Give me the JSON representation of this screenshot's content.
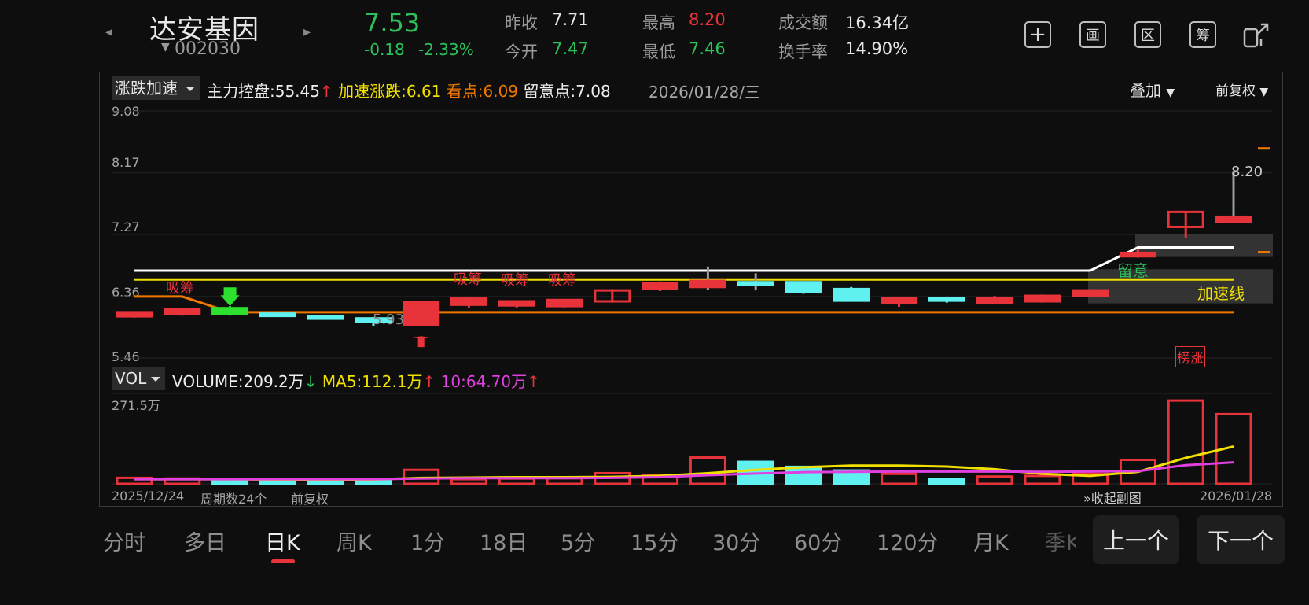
{
  "header": {
    "name": "达安基因",
    "code": "002030",
    "price": "7.53",
    "change": "-0.18",
    "change_pct": "-2.33%",
    "stats": [
      {
        "label": "昨收",
        "value": "7.71"
      },
      {
        "label": "今开",
        "value": "7.47"
      },
      {
        "label": "最高",
        "value": "8.20"
      },
      {
        "label": "最低",
        "value": "7.46"
      },
      {
        "label": "成交额",
        "value": "16.34亿"
      },
      {
        "label": "换手率",
        "value": "14.90%"
      }
    ],
    "tools": [
      "+",
      "画",
      "区",
      "筹",
      "分享"
    ]
  },
  "chart_header": {
    "indicator": "涨跌加速",
    "main_ctrl": "主力控盘:55.45",
    "accel": "加速涨跌:6.61",
    "watch": "看点:6.09",
    "attention": "留意点:7.08",
    "date": "2026/01/28/三",
    "overlay": "叠加",
    "adjust": "前复权"
  },
  "price_axis": [
    "9.08",
    "8.17",
    "7.27",
    "6.36",
    "5.46"
  ],
  "annotations": {
    "xichou": "吸筹",
    "liuyi": "留意",
    "accel_line": "加速线",
    "bangzhang": "榜涨",
    "high": "8.20",
    "low": "5.93"
  },
  "volume_header": {
    "indicator": "VOL",
    "volume": "VOLUME:209.2万",
    "ma5": "MA5:112.1万",
    "ma10": "10:64.70万",
    "axis_max": "271.5万"
  },
  "footer": {
    "start": "2025/12/24",
    "period": "周期数24个",
    "adjust": "前复权",
    "collapse": "收起副图",
    "end": "2026/01/28"
  },
  "tabs": [
    "分时",
    "多日",
    "日K",
    "周K",
    "1分",
    "18日",
    "5分",
    "15分",
    "30分",
    "60分",
    "120分",
    "月K",
    "季K"
  ],
  "nav": {
    "prev": "上一个",
    "next": "下一个"
  },
  "colors": {
    "up": "#e8333a",
    "down": "#5ff0f0",
    "green": "#2dbf5a",
    "ma5": "#f0e000",
    "ma10": "#e040e0",
    "orange": "#f07800"
  },
  "chart_data": {
    "type": "candlestick",
    "ylim": [
      5.46,
      9.08
    ],
    "candles": [
      {
        "o": 6.07,
        "c": 6.13,
        "h": 6.14,
        "l": 6.05,
        "v": 18
      },
      {
        "o": 6.1,
        "c": 6.17,
        "h": 6.18,
        "l": 6.08,
        "v": 16
      },
      {
        "o": 6.19,
        "c": 6.1,
        "h": 6.22,
        "l": 6.08,
        "v": 15
      },
      {
        "o": 6.11,
        "c": 6.08,
        "h": 6.12,
        "l": 6.06,
        "v": 8
      },
      {
        "o": 6.07,
        "c": 6.04,
        "h": 6.09,
        "l": 6.02,
        "v": 7
      },
      {
        "o": 6.04,
        "c": 5.99,
        "h": 6.06,
        "l": 5.93,
        "v": 9
      },
      {
        "o": 5.95,
        "c": 6.28,
        "h": 6.29,
        "l": 5.93,
        "v": 42
      },
      {
        "o": 6.24,
        "c": 6.33,
        "h": 6.35,
        "l": 6.2,
        "v": 14
      },
      {
        "o": 6.23,
        "c": 6.29,
        "h": 6.3,
        "l": 6.2,
        "v": 16
      },
      {
        "o": 6.22,
        "c": 6.31,
        "h": 6.32,
        "l": 6.2,
        "v": 17
      },
      {
        "o": 6.29,
        "c": 6.45,
        "h": 6.47,
        "l": 6.27,
        "v": 32
      },
      {
        "o": 6.48,
        "c": 6.55,
        "h": 6.58,
        "l": 6.44,
        "v": 25
      },
      {
        "o": 6.5,
        "c": 6.59,
        "h": 6.8,
        "l": 6.46,
        "v": 79
      },
      {
        "o": 6.57,
        "c": 6.56,
        "h": 6.7,
        "l": 6.45,
        "v": 66
      },
      {
        "o": 6.57,
        "c": 6.43,
        "h": 6.58,
        "l": 6.4,
        "v": 51
      },
      {
        "o": 6.47,
        "c": 6.3,
        "h": 6.5,
        "l": 6.29,
        "v": 40
      },
      {
        "o": 6.27,
        "c": 6.34,
        "h": 6.35,
        "l": 6.21,
        "v": 30
      },
      {
        "o": 6.34,
        "c": 6.3,
        "h": 6.36,
        "l": 6.27,
        "v": 14
      },
      {
        "o": 6.27,
        "c": 6.34,
        "h": 6.37,
        "l": 6.25,
        "v": 22
      },
      {
        "o": 6.29,
        "c": 6.37,
        "h": 6.39,
        "l": 6.27,
        "v": 24
      },
      {
        "o": 6.37,
        "c": 6.45,
        "h": 6.47,
        "l": 6.35,
        "v": 30
      },
      {
        "o": 6.95,
        "c": 7.0,
        "h": 7.05,
        "l": 6.93,
        "v": 72
      },
      {
        "o": 7.38,
        "c": 7.6,
        "h": 7.61,
        "l": 7.22,
        "v": 250
      },
      {
        "o": 7.46,
        "c": 7.53,
        "h": 8.2,
        "l": 7.46,
        "v": 209.2
      }
    ],
    "ma5": [
      14,
      14,
      14,
      13,
      13,
      13,
      18,
      19,
      20,
      20,
      21,
      24,
      32,
      42,
      50,
      55,
      55,
      52,
      44,
      30,
      24,
      36,
      78,
      112.1
    ],
    "ma10": [
      14,
      14,
      14,
      14,
      14,
      14,
      16,
      17,
      17,
      17,
      18,
      20,
      26,
      31,
      35,
      36,
      37,
      37,
      37,
      36,
      37,
      38,
      56,
      64.7
    ]
  }
}
